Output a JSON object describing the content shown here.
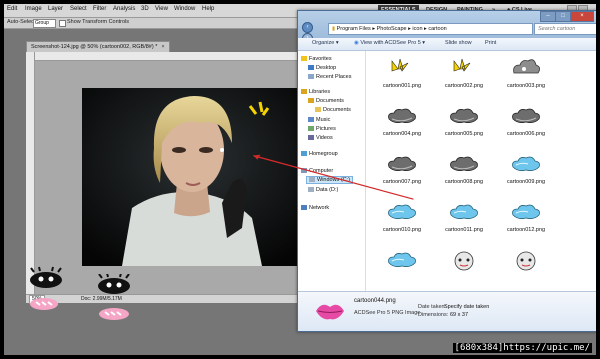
{
  "photoshop": {
    "menu": [
      "Edit",
      "Image",
      "Layer",
      "Select",
      "Filter",
      "Analysis",
      "3D",
      "View",
      "Window",
      "Help"
    ],
    "workspaces": [
      "ESSENTIALS",
      "DESIGN",
      "PAINTING"
    ],
    "more_workspaces": "»",
    "cs_live": "CS Live",
    "options": {
      "auto_select_label": "Auto-Select:",
      "auto_select_value": "Group",
      "show_transform_label": "Show Transform Controls"
    },
    "document_tab": "Screenshot-124.jpg @ 50% (cartoon002, RGB/8#) *",
    "status": {
      "zoom": "50%",
      "doc_info": "Doc: 2.99M/5.17M"
    }
  },
  "explorer": {
    "address": {
      "root": "Program Files",
      "folder1": "PhotoScape",
      "folder2": "icon",
      "folder3": "cartoon"
    },
    "search_placeholder": "Search cartoon",
    "toolbar": {
      "organize": "Organize",
      "view_with": "View with ACDSee Pro 5",
      "slide_show": "Slide show",
      "print": "Print"
    },
    "nav": {
      "favorites": "Favorites",
      "desktop": "Desktop",
      "recent_places": "Recent Places",
      "libraries": "Libraries",
      "documents": "Documents",
      "documents_sub": "Documents",
      "music": "Music",
      "pictures": "Pictures",
      "videos": "Videos",
      "homegroup": "Homegroup",
      "computer": "Computer",
      "windows_c": "Windows (C:)",
      "data_d": "Data (D:)",
      "network": "Network"
    },
    "files": [
      {
        "name": "cartoon001.png",
        "icon": "yellow-shock-lines-icon"
      },
      {
        "name": "cartoon002.png",
        "icon": "yellow-shock-lines-icon"
      },
      {
        "name": "cartoon003.png",
        "icon": "grey-puff-icon"
      },
      {
        "name": "cartoon004.png",
        "icon": "grey-cloud-icon"
      },
      {
        "name": "cartoon005.png",
        "icon": "grey-cloud-icon"
      },
      {
        "name": "cartoon006.png",
        "icon": "grey-cloud-icon"
      },
      {
        "name": "cartoon007.png",
        "icon": "grey-cloud-icon"
      },
      {
        "name": "cartoon008.png",
        "icon": "grey-cloud-icon"
      },
      {
        "name": "cartoon009.png",
        "icon": "blue-cloud-icon"
      },
      {
        "name": "cartoon010.png",
        "icon": "blue-cloud-icon"
      },
      {
        "name": "cartoon011.png",
        "icon": "blue-cloud-icon"
      },
      {
        "name": "cartoon012.png",
        "icon": "blue-cloud-icon"
      },
      {
        "name": "",
        "icon": "blue-cloud-icon"
      },
      {
        "name": "",
        "icon": "cartoon-face-icon"
      },
      {
        "name": "",
        "icon": "cartoon-face-icon"
      }
    ],
    "details": {
      "file_name": "cartoon044.png",
      "file_type": "ACDSee Pro 5 PNG Image",
      "date_taken_label": "Date taken:",
      "date_taken_value": "Specify date taken",
      "dimensions_label": "Dimensions:",
      "dimensions_value": "69 x 37"
    }
  },
  "watermark": "[680x384]https://upic.me/",
  "colors": {
    "ps_workspace_bg": "#767676",
    "explorer_border": "#4a6d96",
    "arrow": "#d42a2a",
    "shock_yellow": "#f6d300"
  }
}
